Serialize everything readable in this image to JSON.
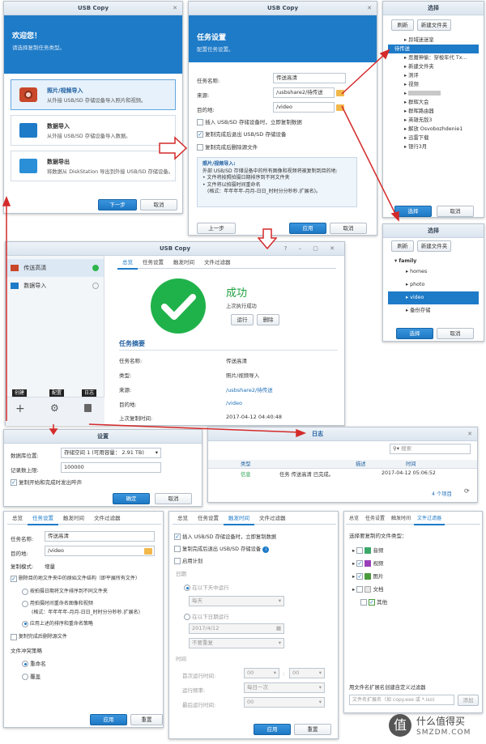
{
  "w1": {
    "title": "USB Copy",
    "welcome": "欢迎您！",
    "choose": "请选择复制任务类型。",
    "opt1_title": "照片/视频导入",
    "opt1_desc": "从外接 USB/SD 存储设备导入照片和视频。",
    "opt2_title": "数据导入",
    "opt2_desc": "从外接 USB/SD 存储设备导入数据。",
    "opt3_title": "数据导出",
    "opt3_desc": "将数据从 DiskStation 导出到外接 USB/SD 存储设备。",
    "next": "下一步",
    "cancel": "取消"
  },
  "w2": {
    "title": "USB Copy",
    "head": "任务设置",
    "sub": "配置任务设置。",
    "name_label": "任务名称:",
    "name_val": "传送高清",
    "src_label": "来源:",
    "src_val": "/usbshare2/待传送",
    "dst_label": "目的地:",
    "dst_val": "/video",
    "chk1": "插入 USB/SD 存储设备时，立即复制数据",
    "chk2": "复制完成后退出 USB/SD 存储设备",
    "chk3": "复制完成后删除源文件",
    "info_title": "照片/视频导入:",
    "info_text": "外部 USB/SD 存储设备中的所有图像和视频将被复制到目的地:",
    "info_b1": "文件将按照拍摄日期排序到不同文件夹",
    "info_b2": "文件将以拍摄时间重命名",
    "info_b3": "(格式：年年年年-月月-日日_时时分分秒秒.扩展名)。",
    "prev": "上一步",
    "apply": "应用",
    "cancel": "取消"
  },
  "sel1": {
    "title": "选择",
    "refresh": "刷新",
    "newfolder": "新建文件夹",
    "items": [
      "异域迷迷皇",
      "待传送",
      "恶魔神偷：穿梭年代 Tx...",
      "新建文件夹",
      "测评",
      "视频",
      "",
      "群辉大会",
      "群晖路由器",
      "英雄无敌3",
      "解放 Osvobozhdenie1",
      "迅雷下载",
      "银行3月"
    ],
    "ok": "选择",
    "cancel": "取消"
  },
  "sel2": {
    "title": "选择",
    "refresh": "刷新",
    "newfolder": "新建文件夹",
    "root": "family",
    "items": [
      "homes",
      "photo",
      "video",
      "备份存储"
    ],
    "ok": "选择",
    "cancel": "取消"
  },
  "main": {
    "title": "USB Copy",
    "side1": "传送高清",
    "side2": "数据导入",
    "create": "创建",
    "config": "配置",
    "log": "日志",
    "tabs": [
      "总览",
      "任务设置",
      "触发时间",
      "文件过滤器"
    ],
    "success": "成功",
    "last_ok": "上次执行成功",
    "run": "运行",
    "delete": "删除",
    "summary": "任务摘要",
    "rows": [
      [
        "任务名称:",
        "传送高清"
      ],
      [
        "类型:",
        "照片/视频导入"
      ],
      [
        "来源:",
        "/usbshare2/待传送"
      ],
      [
        "目的地:",
        "/video"
      ],
      [
        "上次复制时间:",
        "2017-04-12 04:40:48"
      ]
    ]
  },
  "settings": {
    "title": "设置",
    "loc_label": "数据库位置:",
    "loc_val": "存储空间 1 (可用容量： 2.91 TB)",
    "max_label": "记录数上限:",
    "max_val": "100000",
    "chk": "复制开始和完成时发出哔声",
    "ok": "确定",
    "cancel": "取消"
  },
  "logw": {
    "title": "日志",
    "search": "搜索",
    "cols": [
      "类型",
      "描述",
      "时间"
    ],
    "row": [
      "信息",
      "任务 传送高清 已完成。",
      "2017-04-12 05:06:52"
    ],
    "count": "4 个项目"
  },
  "bl": {
    "tabs": [
      "总览",
      "任务设置",
      "触发时间",
      "文件过滤器"
    ],
    "name_label": "任务名称:",
    "name_val": "传送高清",
    "dst_label": "目的地:",
    "dst_val": "/video",
    "mode_label": "复制模式:",
    "mode_val": "增量",
    "chk1": "删除目的地文件夹中的原始文件结构（即平展所有文件）",
    "r1": "按拍摄日期将文件排序到不同文件夹",
    "r2": "用拍摄时间重命名图像和视频",
    "r2b": "(格式：年年年年-月月-日日_时时分分秒秒.扩展名)",
    "r3": "应用上述的排序和重命名策略",
    "chk2": "复制完成后删除源文件",
    "conflict": "文件冲突策略",
    "c1": "重命名",
    "c2": "覆盖",
    "apply": "应用",
    "reset": "重置"
  },
  "bm": {
    "tabs": [
      "总览",
      "任务设置",
      "触发时间",
      "文件过滤器"
    ],
    "chk1": "插入 USB/SD 存储设备时，立即复制数据",
    "chk2": "复制完成后退出 USB/SD 存储设备",
    "chk3": "启用计划",
    "date": "日期",
    "r1": "在以下天中运行",
    "everyday": "每天",
    "r2": "在以下日期运行",
    "dateval": "2017/4/12",
    "norepeat": "不要重复",
    "time": "时间",
    "t1": "首次运行时间:",
    "t2": "运行频率:",
    "t2v": "每日一次",
    "t3": "最后运行时间:",
    "zero": "00",
    "apply": "应用",
    "reset": "重置"
  },
  "br": {
    "tabs": [
      "总览",
      "任务设置",
      "触发时间",
      "文件过滤器"
    ],
    "choose": "选择要复制的文件类型：",
    "types": [
      "音频",
      "视频",
      "图片",
      "文档",
      "其他"
    ],
    "ext_label": "用文件名扩展名创建自定义过滤器",
    "ext_ph": "文件名扩展名（如 copy.exe 或 *.iso)",
    "add": "添加"
  },
  "watermark": {
    "text": "什么值得买",
    "url": "SMZDM.COM"
  }
}
